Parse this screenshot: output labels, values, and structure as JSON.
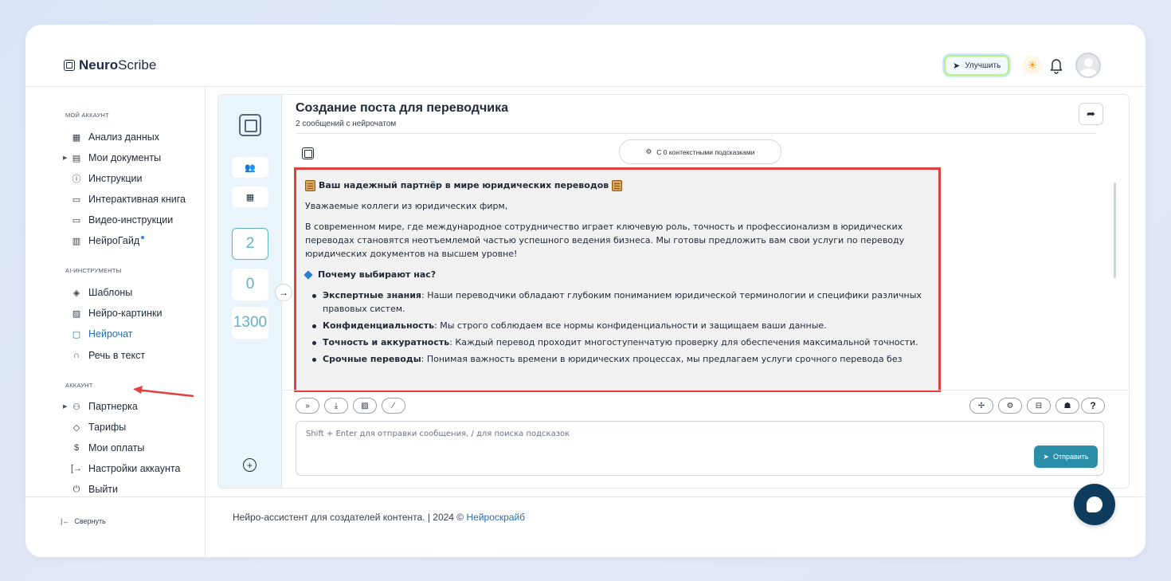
{
  "header": {
    "logo_bold": "Neuro",
    "logo_light": "Scribe",
    "upgrade_label": "Улучшить"
  },
  "sidebar": {
    "sections": [
      {
        "title": "МОЙ АККАУНТ"
      },
      {
        "title": "AI-ИНСТРУМЕНТЫ"
      },
      {
        "title": "АККАУНТ"
      }
    ],
    "items": [
      {
        "label": "Анализ данных",
        "icon": "grid-icon"
      },
      {
        "label": "Мои документы",
        "icon": "document-icon"
      },
      {
        "label": "Инструкции",
        "icon": "help-circle-icon"
      },
      {
        "label": "Интерактивная книга",
        "icon": "book-icon"
      },
      {
        "label": "Видео-инструкции",
        "icon": "video-icon"
      },
      {
        "label": "НейроГайд",
        "icon": "guide-icon"
      },
      {
        "label": "Шаблоны",
        "icon": "layers-icon"
      },
      {
        "label": "Нейро-картинки",
        "icon": "image-icon"
      },
      {
        "label": "Нейрочат",
        "icon": "chat-icon"
      },
      {
        "label": "Речь в текст",
        "icon": "headphones-icon"
      },
      {
        "label": "Партнерка",
        "icon": "users-icon"
      },
      {
        "label": "Тарифы",
        "icon": "tag-icon"
      },
      {
        "label": "Мои оплаты",
        "icon": "dollar-icon"
      },
      {
        "label": "Настройки аккаунта",
        "icon": "login-icon"
      },
      {
        "label": "Выйти",
        "icon": "power-icon"
      }
    ],
    "collapse_label": "Свернуть"
  },
  "rail": {
    "count_chats": "2",
    "count_zero": "0",
    "count_tokens": "1300"
  },
  "chat": {
    "title": "Создание поста для переводчика",
    "subtitle": "2 сообщений с нейрочатом",
    "context_label": "С 0 контекстными подсказками",
    "message": {
      "heading": "Ваш надежный партнёр в мире юридических переводов",
      "greeting": "Уважаемые коллеги из юридических фирм,",
      "intro": "В современном мире, где международное сотрудничество играет ключевую роль, точность и профессионализм в юридических переводах становятся неотъемлемой частью успешного ведения бизнеса. Мы готовы предложить вам свои услуги по переводу юридических документов на высшем уровне!",
      "why_heading": "Почему выбирают нас?",
      "bullets": [
        {
          "bold": "Экспертные знания",
          "text": ": Наши переводчики обладают глубоким пониманием юридической терминологии и специфики различных правовых систем."
        },
        {
          "bold": "Конфиденциальность",
          "text": ": Мы строго соблюдаем все нормы конфиденциальности и защищаем ваши данные."
        },
        {
          "bold": "Точность и аккуратность",
          "text": ": Каждый перевод проходит многоступенчатую проверку для обеспечения максимальной точности."
        },
        {
          "bold": "Срочные переводы",
          "text": ": Понимая важность времени в юридических процессах, мы предлагаем услуги срочного перевода без"
        }
      ]
    },
    "input_placeholder": "Shift + Enter для отправки сообщения, / для поиска подсказок",
    "send_label": "Отправить",
    "help_label": "?"
  },
  "footer": {
    "text": "Нейро-ассистент для создателей контента.  | 2024 © ",
    "link": "Нейроскрайб"
  }
}
